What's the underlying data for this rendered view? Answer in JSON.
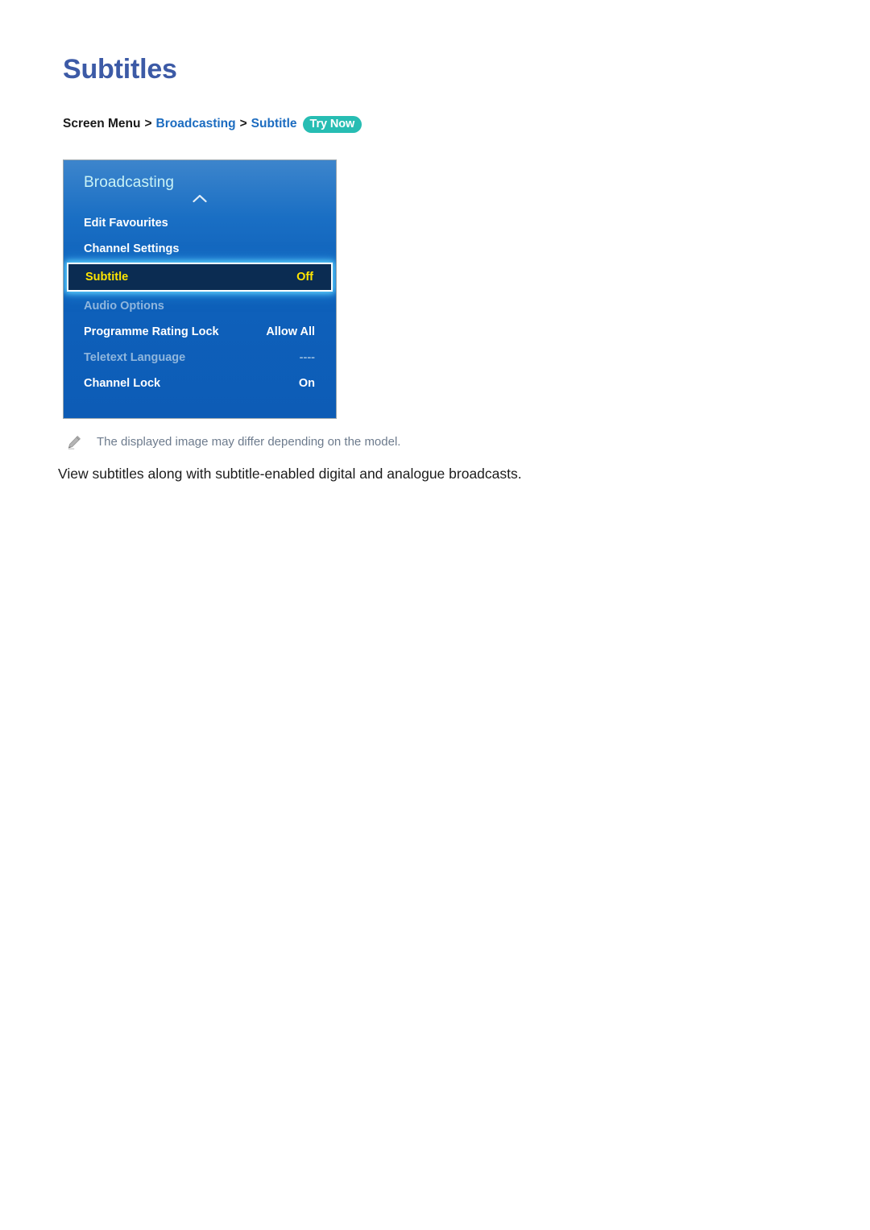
{
  "page": {
    "title": "Subtitles"
  },
  "breadcrumb": {
    "root": "Screen Menu",
    "separator": ">",
    "level1": "Broadcasting",
    "level2": "Subtitle",
    "badge": "Try Now",
    "badge_color": "#27bdb3",
    "link_color": "#1c6cc0"
  },
  "tv_menu": {
    "header": "Broadcasting",
    "chevron_icon": "chevron-up-icon",
    "accent_highlight_color": "#ffe500",
    "selected_row_bg": "#0b2c52",
    "panel_color": "#0d5cb6",
    "items": [
      {
        "label": "Edit Favourites",
        "value": "",
        "state": "normal"
      },
      {
        "label": "Channel Settings",
        "value": "",
        "state": "normal"
      },
      {
        "label": "Subtitle",
        "value": "Off",
        "state": "selected"
      },
      {
        "label": "Audio Options",
        "value": "",
        "state": "disabled"
      },
      {
        "label": "Programme Rating Lock",
        "value": "Allow All",
        "state": "normal"
      },
      {
        "label": "Teletext Language",
        "value": "----",
        "state": "disabled"
      },
      {
        "label": "Channel Lock",
        "value": "On",
        "state": "normal"
      }
    ]
  },
  "note": {
    "icon": "pencil-icon",
    "text": "The displayed image may differ depending on the model."
  },
  "body": {
    "paragraph": "View subtitles along with subtitle-enabled digital and analogue broadcasts."
  }
}
